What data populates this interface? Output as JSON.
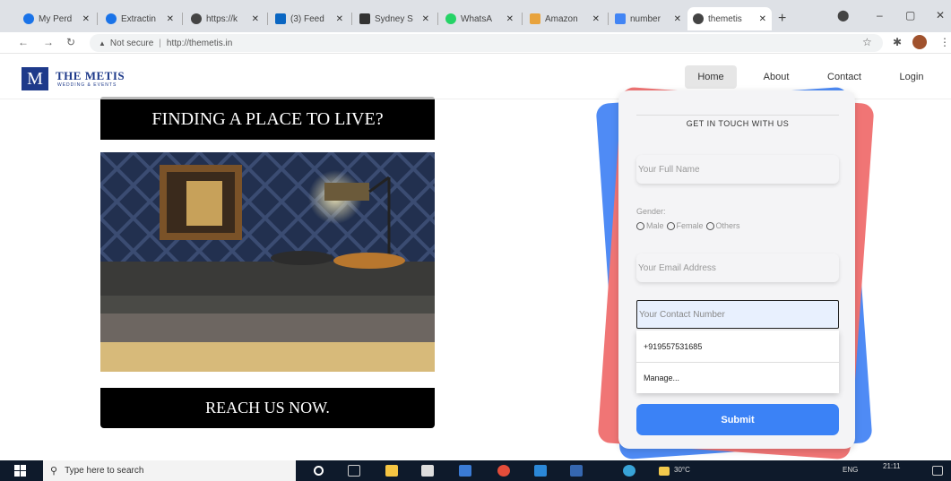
{
  "browser": {
    "tabs": [
      {
        "label": "My Perd",
        "color": "#1a73e8"
      },
      {
        "label": "Extractin",
        "color": "#1a73e8"
      },
      {
        "label": "https://k",
        "color": "#444444"
      },
      {
        "label": "(3) Feed",
        "color": "#0a66c2"
      },
      {
        "label": "Sydney S",
        "color": "#333333"
      },
      {
        "label": "WhatsA",
        "color": "#25d366"
      },
      {
        "label": "Amazon",
        "color": "#e8a33d"
      },
      {
        "label": "number",
        "color": "#4285f4"
      },
      {
        "label": "themetis",
        "color": "#444444"
      }
    ],
    "close_glyph": "✕",
    "new_tab": "+",
    "window_controls": [
      "⬤",
      "–",
      "▢",
      "✕"
    ],
    "nav": {
      "back": "←",
      "forward": "→",
      "reload": "↻"
    },
    "security_icon": "▲",
    "security_text": "Not secure",
    "separator": "|",
    "url": "http://themetis.in",
    "star": "☆",
    "extension": "✱",
    "menu": "⋮"
  },
  "site": {
    "logo_mark": "M",
    "logo_text": "THE METIS",
    "logo_sub": "WEDDING & EVENTS",
    "nav": [
      "Home",
      "About",
      "Contact",
      "Login"
    ],
    "promo_top": "FINDING A PLACE TO LIVE?",
    "promo_bottom": "REACH US NOW.",
    "form": {
      "title": "GET IN TOUCH WITH US",
      "name_placeholder": "Your Full Name",
      "gender_label": "Gender:",
      "gender_options": [
        "Male",
        "Female",
        "Others"
      ],
      "email_placeholder": "Your Email Address",
      "contact_placeholder": "Your Contact Number",
      "suggestions": [
        "+919557531685",
        "Manage..."
      ],
      "submit": "Submit"
    }
  },
  "taskbar": {
    "search": "Type here to search",
    "weather": "30°C",
    "lang": "ENG",
    "time": "21:11"
  },
  "colors": {
    "brand": "#1e3a8a",
    "submit": "#3b82f6",
    "card_blue": "#4f8bf5",
    "card_red": "#f07575"
  }
}
